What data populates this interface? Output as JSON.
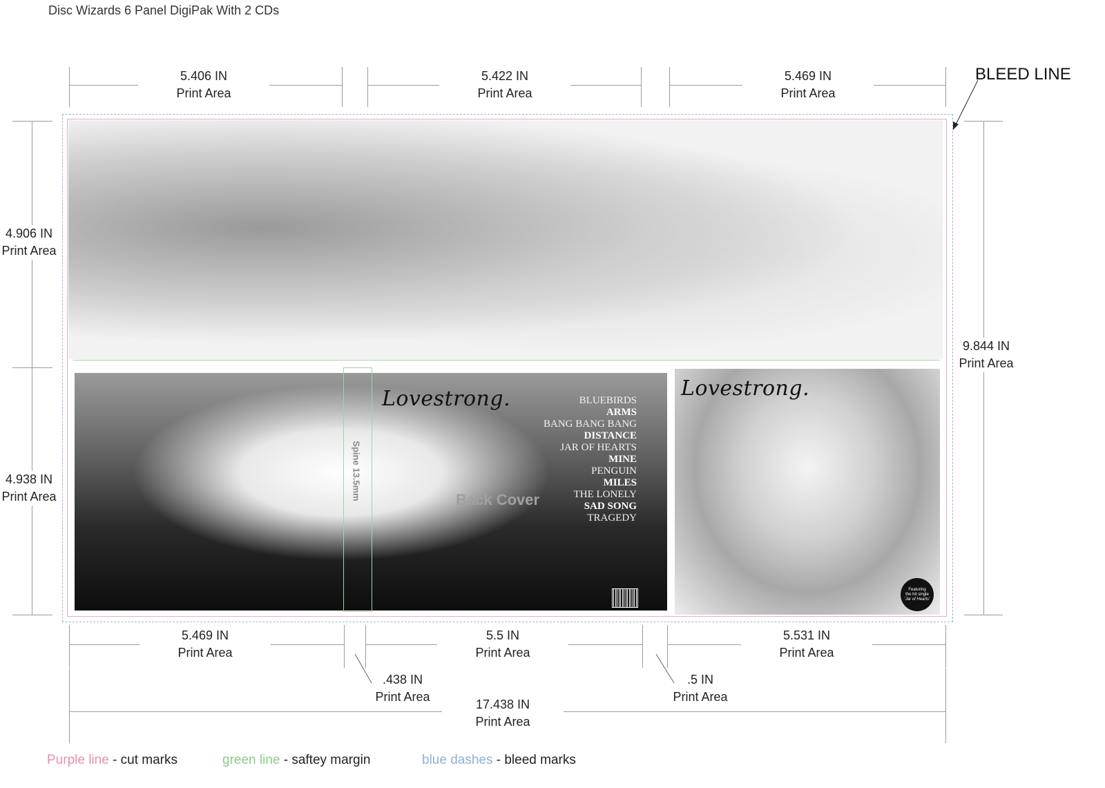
{
  "title": "Disc Wizards 6 Panel DigiPak With 2 CDs",
  "bleed_label": "BLEED LINE",
  "top_dimensions": [
    {
      "value": "5.406 IN",
      "label": "Print Area"
    },
    {
      "value": "5.422 IN",
      "label": "Print Area"
    },
    {
      "value": "5.469 IN",
      "label": "Print Area"
    }
  ],
  "left_dimensions": [
    {
      "value": "4.906 IN",
      "label": "Print Area"
    },
    {
      "value": "4.938 IN",
      "label": "Print Area"
    }
  ],
  "right_dimension": {
    "value": "9.844 IN",
    "label": "Print Area"
  },
  "bottom_dimensions": [
    {
      "value": "5.469 IN",
      "label": "Print Area"
    },
    {
      "value": "5.5 IN",
      "label": "Print Area"
    },
    {
      "value": "5.531 IN",
      "label": "Print Area"
    }
  ],
  "spine_dimensions": [
    {
      "value": ".438 IN",
      "label": "Print Area"
    },
    {
      "value": ".5 IN",
      "label": "Print Area"
    }
  ],
  "total_dimension": {
    "value": "17.438 IN",
    "label": "Print Area"
  },
  "album": {
    "logo": "Lovestrong.",
    "spine_label": "Spine 13.5mm",
    "back_label": "Back Cover",
    "tracks": [
      {
        "name": "BLUEBIRDS",
        "bold": false
      },
      {
        "name": "ARMS",
        "bold": true
      },
      {
        "name": "BANG BANG BANG",
        "bold": false
      },
      {
        "name": "DISTANCE",
        "bold": true
      },
      {
        "name": "JAR OF HEARTS",
        "bold": false
      },
      {
        "name": "MINE",
        "bold": true
      },
      {
        "name": "PENGUIN",
        "bold": false
      },
      {
        "name": "MILES",
        "bold": true
      },
      {
        "name": "THE LONELY",
        "bold": false
      },
      {
        "name": "SAD SONG",
        "bold": true
      },
      {
        "name": "TRAGEDY",
        "bold": false
      }
    ],
    "badge_line1": "Featuring",
    "badge_line2": "the hit single",
    "badge_line3": "'Jar of Hearts'"
  },
  "legend": [
    {
      "key": "Purple line",
      "desc": " - cut marks",
      "color": "#e88fb0"
    },
    {
      "key": "green line",
      "desc": " - saftey margin",
      "color": "#8fc98f"
    },
    {
      "key": "blue dashes",
      "desc": " - bleed marks",
      "color": "#8fb0d4"
    }
  ]
}
